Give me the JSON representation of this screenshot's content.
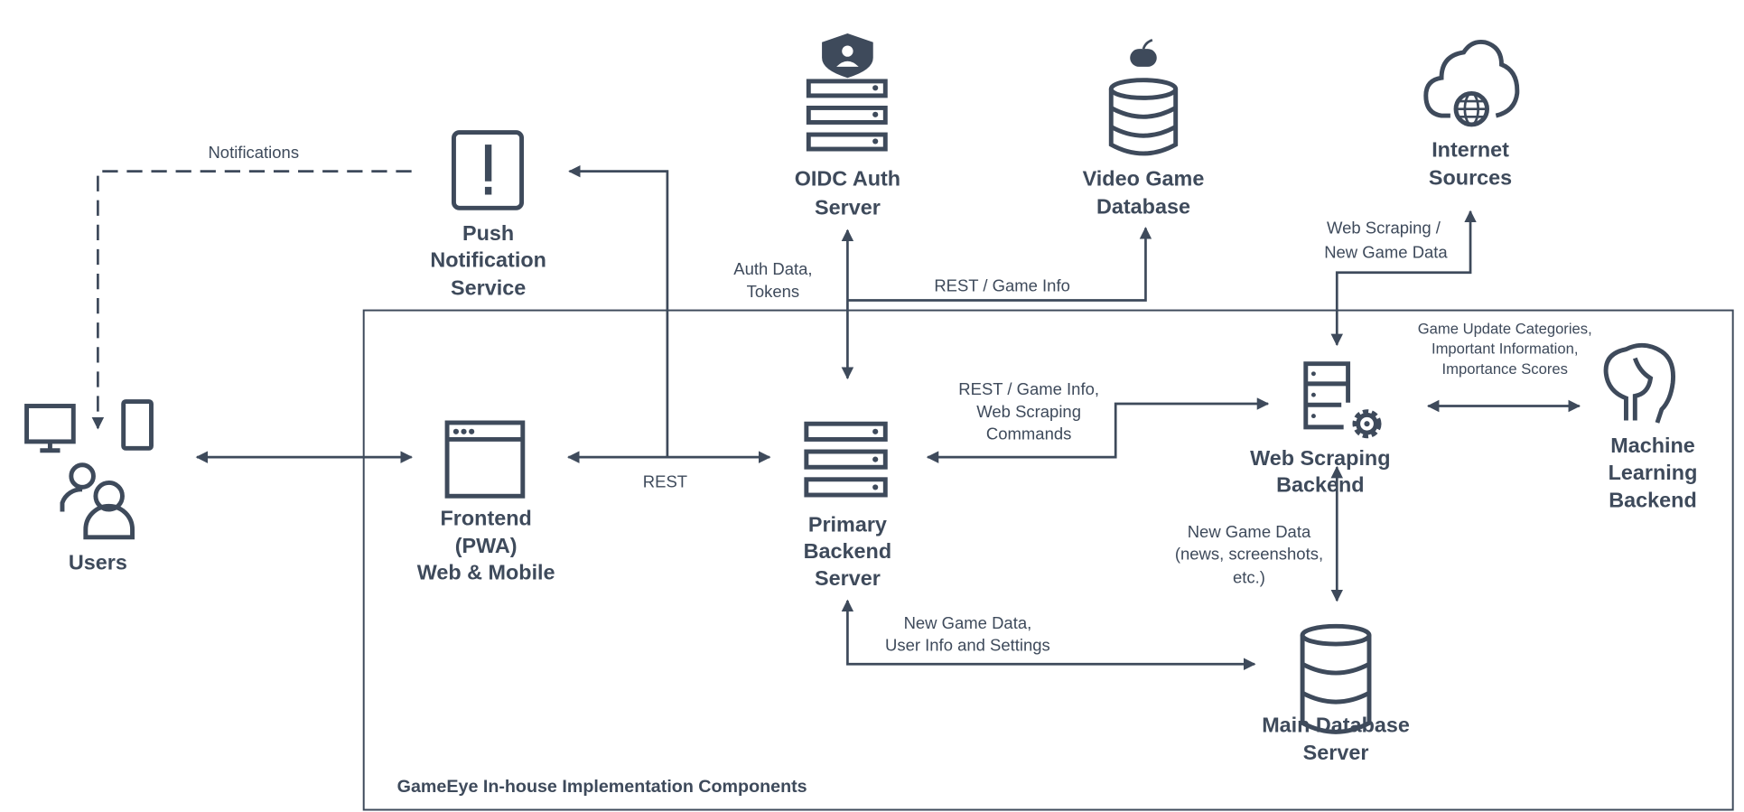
{
  "diagram": {
    "color": "#3e4a5b",
    "boundary_label": "GameEye In-house Implementation Components",
    "nodes": {
      "users": {
        "label": "Users",
        "icon": "users-devices-icon"
      },
      "push": {
        "lines": [
          "Push",
          "Notification",
          "Service"
        ],
        "icon": "alert-phone-icon"
      },
      "oidc": {
        "lines": [
          "OIDC Auth",
          "Server"
        ],
        "icon": "shield-server-icon"
      },
      "videodb": {
        "lines": [
          "Video Game",
          "Database"
        ],
        "icon": "gamepad-database-icon"
      },
      "internet": {
        "lines": [
          "Internet",
          "Sources"
        ],
        "icon": "cloud-globe-icon"
      },
      "frontend": {
        "lines": [
          "Frontend",
          "(PWA)",
          "Web & Mobile"
        ],
        "icon": "browser-window-icon"
      },
      "primary": {
        "lines": [
          "Primary",
          "Backend",
          "Server"
        ],
        "icon": "server-icon"
      },
      "scraper": {
        "lines": [
          "Web Scraping",
          "Backend"
        ],
        "icon": "server-gear-icon"
      },
      "ml": {
        "lines": [
          "Machine",
          "Learning",
          "Backend"
        ],
        "icon": "brain-icon"
      },
      "maindb": {
        "lines": [
          "Main Database",
          "Server"
        ],
        "icon": "database-icon"
      }
    },
    "edges": {
      "notifications": "Notifications",
      "auth": [
        "Auth Data,",
        "Tokens"
      ],
      "rest_game_info": "REST / Game Info",
      "web_scraping": [
        "Web Scraping /",
        "New Game Data"
      ],
      "ml_data": [
        "Game Update Categories,",
        "Important Information,",
        "Importance Scores"
      ],
      "rest": "REST",
      "scrape_cmds": [
        "REST / Game Info,",
        "Web Scraping",
        "Commands"
      ],
      "new_game_data": [
        "New Game Data",
        "(news, screenshots,",
        "etc.)"
      ],
      "user_info": [
        "New Game Data,",
        "User Info and Settings"
      ]
    }
  }
}
